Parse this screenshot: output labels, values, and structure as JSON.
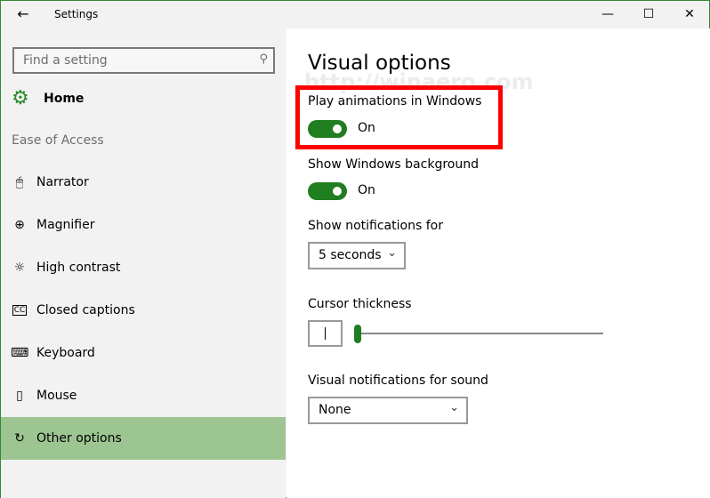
{
  "window": {
    "title": "Settings",
    "back_icon": "back-arrow-icon",
    "controls": [
      "minimize",
      "maximize",
      "close"
    ]
  },
  "sidebar": {
    "search_placeholder": "Find a setting",
    "home": "Home",
    "section": "Ease of Access",
    "items": [
      {
        "label": "Narrator",
        "icon": "narrator-icon"
      },
      {
        "label": "Magnifier",
        "icon": "magnifier-icon"
      },
      {
        "label": "High contrast",
        "icon": "high-contrast-icon"
      },
      {
        "label": "Closed captions",
        "icon": "closed-captions-icon"
      },
      {
        "label": "Keyboard",
        "icon": "keyboard-icon"
      },
      {
        "label": "Mouse",
        "icon": "mouse-icon"
      },
      {
        "label": "Other options",
        "icon": "other-options-icon",
        "selected": true
      }
    ]
  },
  "main": {
    "title": "Visual options",
    "watermark": "http://winaero.com",
    "play_animations": {
      "label": "Play animations in Windows",
      "state": "On"
    },
    "show_background": {
      "label": "Show Windows background",
      "state": "On"
    },
    "notifications": {
      "label": "Show notifications for",
      "value": "5 seconds"
    },
    "cursor": {
      "label": "Cursor thickness",
      "value": 1
    },
    "sound": {
      "label": "Visual notifications for sound",
      "value": "None"
    }
  },
  "colors": {
    "accent": "#1f7e1f",
    "selected": "#9cc592",
    "highlight": "#ff0000"
  }
}
